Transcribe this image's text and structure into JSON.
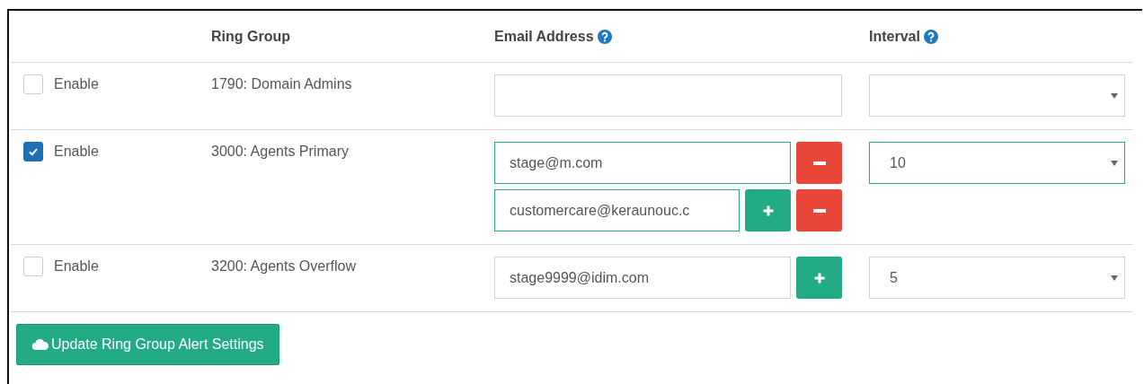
{
  "columns": [
    {
      "label": "Ring Group",
      "help": false
    },
    {
      "label": "Email Address",
      "help": true
    },
    {
      "label": "Interval",
      "help": true
    }
  ],
  "rows": [
    {
      "enable_label": "Enable",
      "enabled": false,
      "group": "1790: Domain Admins",
      "interval": ""
    },
    {
      "enable_label": "Enable",
      "enabled": true,
      "group": "3000: Agents Primary",
      "emails": [
        {
          "value": "stage@m.com",
          "actions": [
            {
              "kind": "remove"
            }
          ]
        },
        {
          "value": "customercare@keraunouc.c",
          "actions": [
            {
              "kind": "add"
            },
            {
              "kind": "remove"
            }
          ]
        }
      ],
      "interval": "10"
    },
    {
      "enable_label": "Enable",
      "enabled": false,
      "group": "3200: Agents Overflow",
      "emails": [
        {
          "value": "stage9999@idim.com",
          "actions": [
            {
              "kind": "add"
            }
          ]
        }
      ],
      "interval": "5"
    }
  ],
  "submit": {
    "label": "Update Ring Group Alert Settings"
  }
}
